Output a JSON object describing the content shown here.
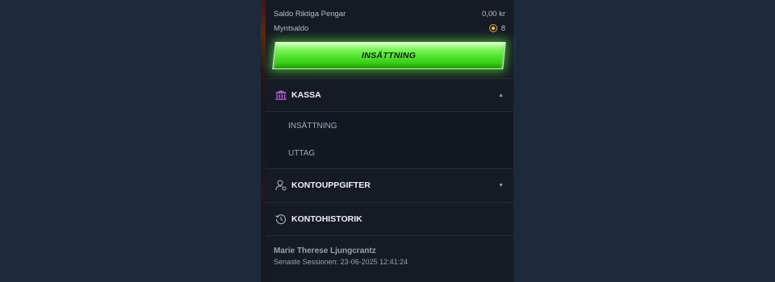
{
  "balances": {
    "real_money_label": "Saldo Riktiga Pengar",
    "real_money_value": "0,00 kr",
    "coin_label": "Myntsaldo",
    "coin_value": "8"
  },
  "deposit_button": {
    "label": "INSÄTTNING",
    "color": "#4fe82a"
  },
  "kassa": {
    "label": "KASSA",
    "icon": "bank-icon",
    "icon_color": "#b14fd8",
    "expanded": true,
    "items": [
      {
        "label": "INSÄTTNING"
      },
      {
        "label": "UTTAG"
      }
    ]
  },
  "account_details": {
    "label": "KONTOUPPGIFTER",
    "icon": "user-settings-icon",
    "expanded": false
  },
  "account_history": {
    "label": "KONTOHISTORIK",
    "icon": "history-icon"
  },
  "user": {
    "name": "Marie Therese Ljungcrantz",
    "last_session": "Senaste Sessionen: 23-06-2025 12:41:24"
  },
  "colors": {
    "page_bg": "#1c2a3c",
    "panel_bg": "#161a24"
  }
}
